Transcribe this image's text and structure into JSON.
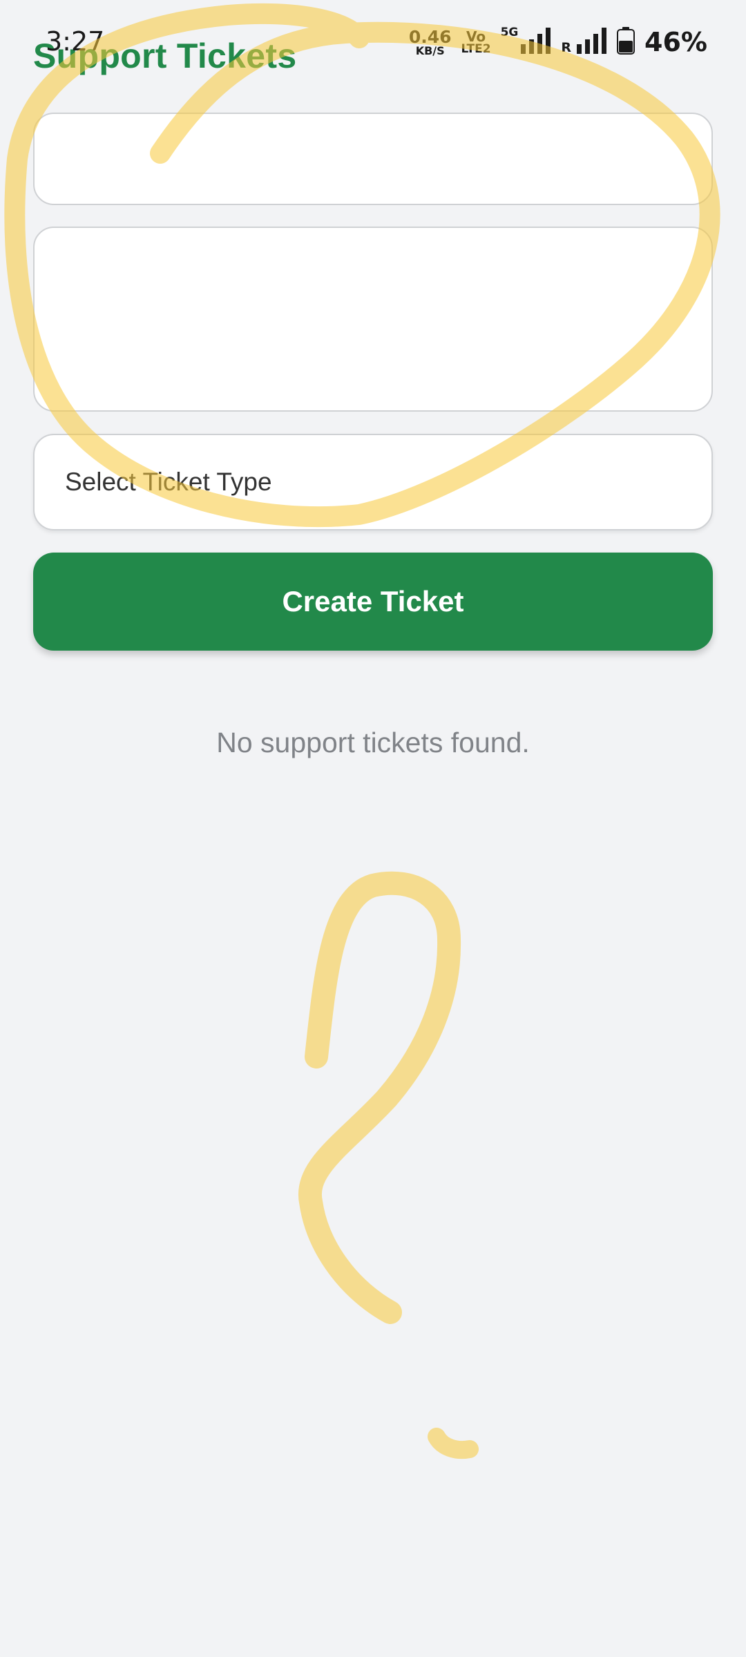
{
  "status_bar": {
    "time": "3:27",
    "net_speed_value": "0.46",
    "net_speed_unit": "KB/S",
    "volte_top": "Vo",
    "volte_bottom": "LTE2",
    "network_type": "5G",
    "roaming": "R",
    "battery_percent": "46%"
  },
  "header": {
    "title": "Support Tickets"
  },
  "form": {
    "subject_value": "",
    "description_value": "",
    "ticket_type_label": "Select Ticket Type",
    "create_button_label": "Create Ticket"
  },
  "tickets": {
    "empty_message": "No support tickets found."
  },
  "colors": {
    "brand_green": "#22894a",
    "background": "#f2f3f5",
    "highlighter": "#f7c93a"
  },
  "icons": [
    "signal-icon",
    "battery-icon"
  ]
}
